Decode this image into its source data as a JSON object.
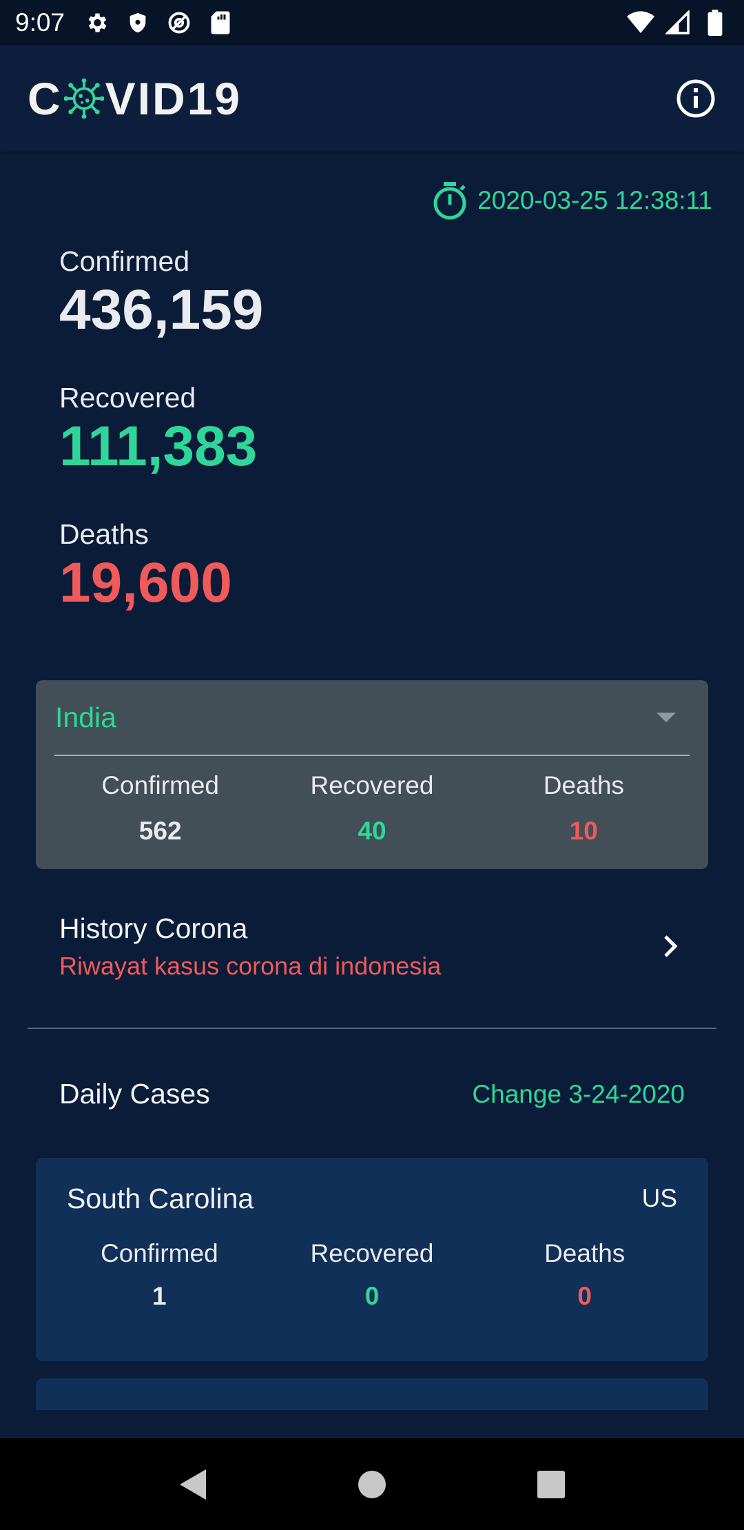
{
  "status_bar": {
    "time": "9:07",
    "left_icons": [
      "settings-icon",
      "shield-icon",
      "at-sign-icon",
      "sd-card-icon"
    ],
    "right_icons": [
      "wifi-icon",
      "cellular-signal-icon",
      "battery-icon"
    ]
  },
  "app_bar": {
    "logo_prefix": "C",
    "logo_suffix": "VID19",
    "logo_icon": "virus-icon",
    "info_icon": "info-icon"
  },
  "timestamp": {
    "icon": "stopwatch-icon",
    "value": "2020-03-25 12:38:11"
  },
  "global": {
    "confirmed_label": "Confirmed",
    "confirmed_value": "436,159",
    "recovered_label": "Recovered",
    "recovered_value": "111,383",
    "deaths_label": "Deaths",
    "deaths_value": "19,600"
  },
  "country_card": {
    "selected_country": "India",
    "confirmed_label": "Confirmed",
    "confirmed_value": "562",
    "recovered_label": "Recovered",
    "recovered_value": "40",
    "deaths_label": "Deaths",
    "deaths_value": "10"
  },
  "history": {
    "title": "History Corona",
    "subtitle": "Riwayat kasus corona di indonesia"
  },
  "daily": {
    "title": "Daily Cases",
    "change": "Change 3-24-2020",
    "cards": [
      {
        "region": "South Carolina",
        "country": "US",
        "confirmed_label": "Confirmed",
        "confirmed_value": "1",
        "recovered_label": "Recovered",
        "recovered_value": "0",
        "deaths_label": "Deaths",
        "deaths_value": "0"
      }
    ]
  },
  "nav_bar": {
    "icons": [
      "back-icon",
      "home-icon",
      "recents-icon"
    ]
  },
  "colors": {
    "background": "#0b1c38",
    "app_bar": "#0c1e3b",
    "accent_green": "#2fd69a",
    "deaths_red": "#f05a5a",
    "country_card": "#424f56",
    "case_card": "#113057"
  }
}
